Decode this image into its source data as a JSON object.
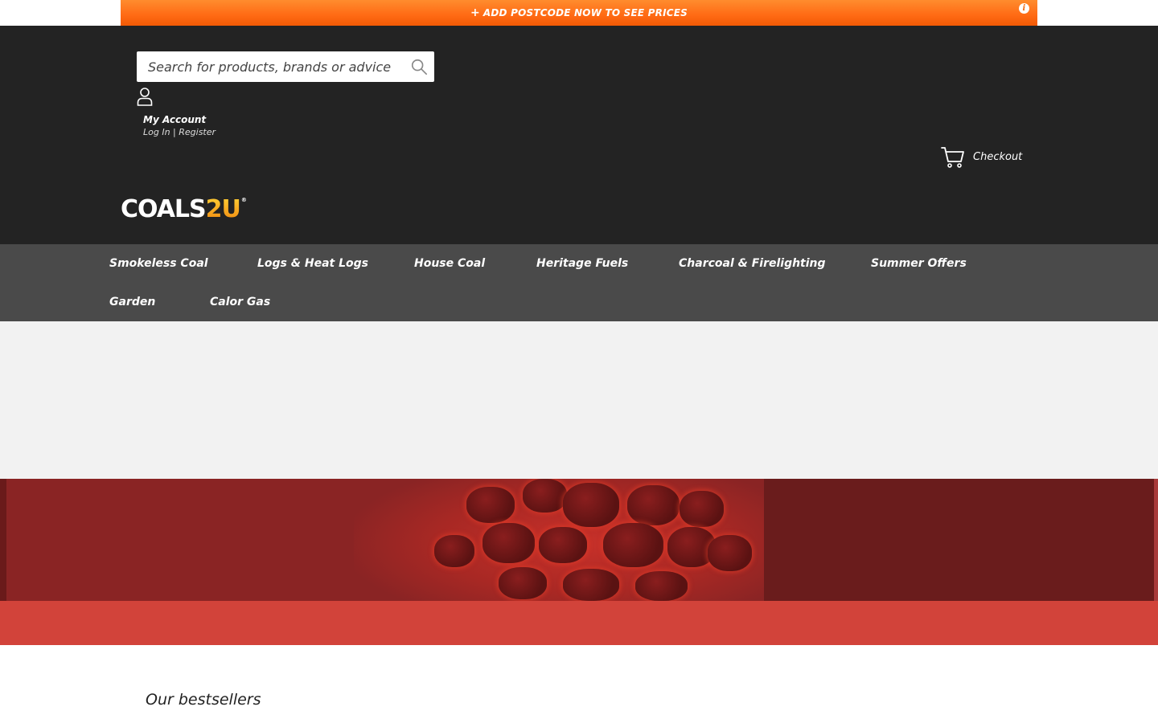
{
  "promo": {
    "plus": "+",
    "text": "ADD POSTCODE NOW TO SEE PRICES",
    "info": "i"
  },
  "search": {
    "placeholder": "Search for products, brands or advice"
  },
  "account": {
    "title": "My Account",
    "sub": "Log In | Register"
  },
  "cart": {
    "label": "Checkout"
  },
  "logo": {
    "coals": "COALS",
    "two_u": "2U",
    "reg": "®"
  },
  "nav": {
    "items": [
      "Smokeless Coal",
      "Logs & Heat Logs",
      "House Coal",
      "Heritage Fuels",
      "Charcoal & Firelighting",
      "Summer Offers",
      "Garden",
      "Calor Gas"
    ]
  },
  "main": {
    "bestsellers_heading": "Our bestsellers"
  },
  "colors": {
    "promo_orange": "#ff6a14",
    "header_bg": "#232323",
    "nav_bg": "#4a4a4a",
    "banner_red": "#8a2424",
    "strip_red": "#d2433a"
  },
  "icons": {
    "search": "search-icon",
    "account": "user-icon",
    "cart": "cart-icon",
    "info": "info-icon"
  }
}
